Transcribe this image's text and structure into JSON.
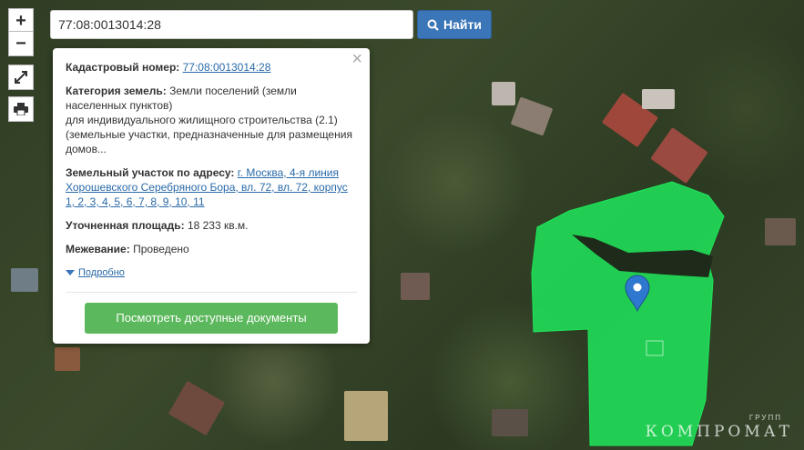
{
  "search": {
    "value": "77:08:0013014:28"
  },
  "search_button": {
    "label": "Найти",
    "icon": "search-icon"
  },
  "controls": {
    "zoom_in": "+",
    "zoom_out": "−",
    "fullscreen_icon": "expand-icon",
    "print_icon": "printer-icon"
  },
  "popup": {
    "cadastral_label": "Кадастровый номер:",
    "cadastral_value": "77:08:0013014:28",
    "category_label": "Категория земель:",
    "category_value": "Земли поселений (земли населенных пунктов)",
    "category_detail": "для индивидуального жилищного строительства (2.1) (земельные участки, предназначенные для размещения домов...",
    "address_label": "Земельный участок по адресу:",
    "address_value": "г. Москва, 4-я линия Хорошевского Серебряного Бора, вл. 72, вл. 72, корпус 1, 2, 3, 4, 5, 6, 7, 8, 9, 10, 11",
    "area_label": "Уточненная площадь:",
    "area_value": "18 233 кв.м.",
    "survey_label": "Межевание:",
    "survey_value": "Проведено",
    "more_label": "Подробно",
    "docs_button": "Посмотреть доступные документы",
    "close": "×"
  },
  "map": {
    "marker_icon": "map-pin-icon",
    "parcel_color": "#1ee65a"
  },
  "watermark": {
    "main": "КОМПРОМАТ",
    "sub": "ГРУПП"
  }
}
